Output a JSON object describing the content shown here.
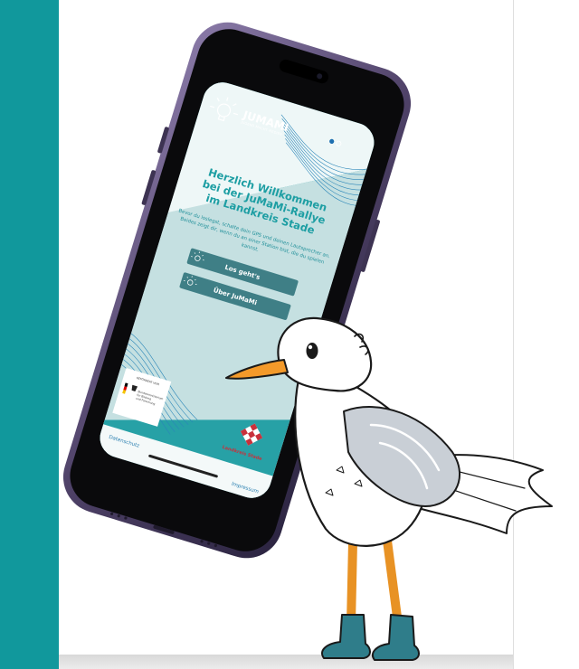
{
  "app": {
    "logo_text": "JUMAMI",
    "logo_tagline": "JUGEND MACHT MEDIEN",
    "welcome_line1": "Herzlich Willkommen",
    "welcome_line2": "bei der JuMaMi-Rallye",
    "welcome_line3": "im Landkreis Stade",
    "intro_line1": "Bevor du loslegst, schalte dein GPS und deinen Lautsprecher an.",
    "intro_line2": "Beides zeigt dir, wenn du an einer Station bist, die du spielen",
    "intro_line3": "kannst.",
    "start_button": "Los geht's",
    "about_button": "Über JuMaMi",
    "funder_caption": "GEFÖRDERT VOM",
    "funder_name_line1": "Bundesministerium",
    "funder_name_line2": "für Bildung",
    "funder_name_line3": "und Forschung",
    "partner_label": "Landkreis Stade",
    "privacy_link": "Datenschutz",
    "imprint_link": "Impressum"
  },
  "colors": {
    "accent": "#11989c",
    "button": "#3f7f86",
    "phone_frame": "#5a4a78",
    "gull_beak": "#f39a2a",
    "boots": "#2f7d8a"
  }
}
